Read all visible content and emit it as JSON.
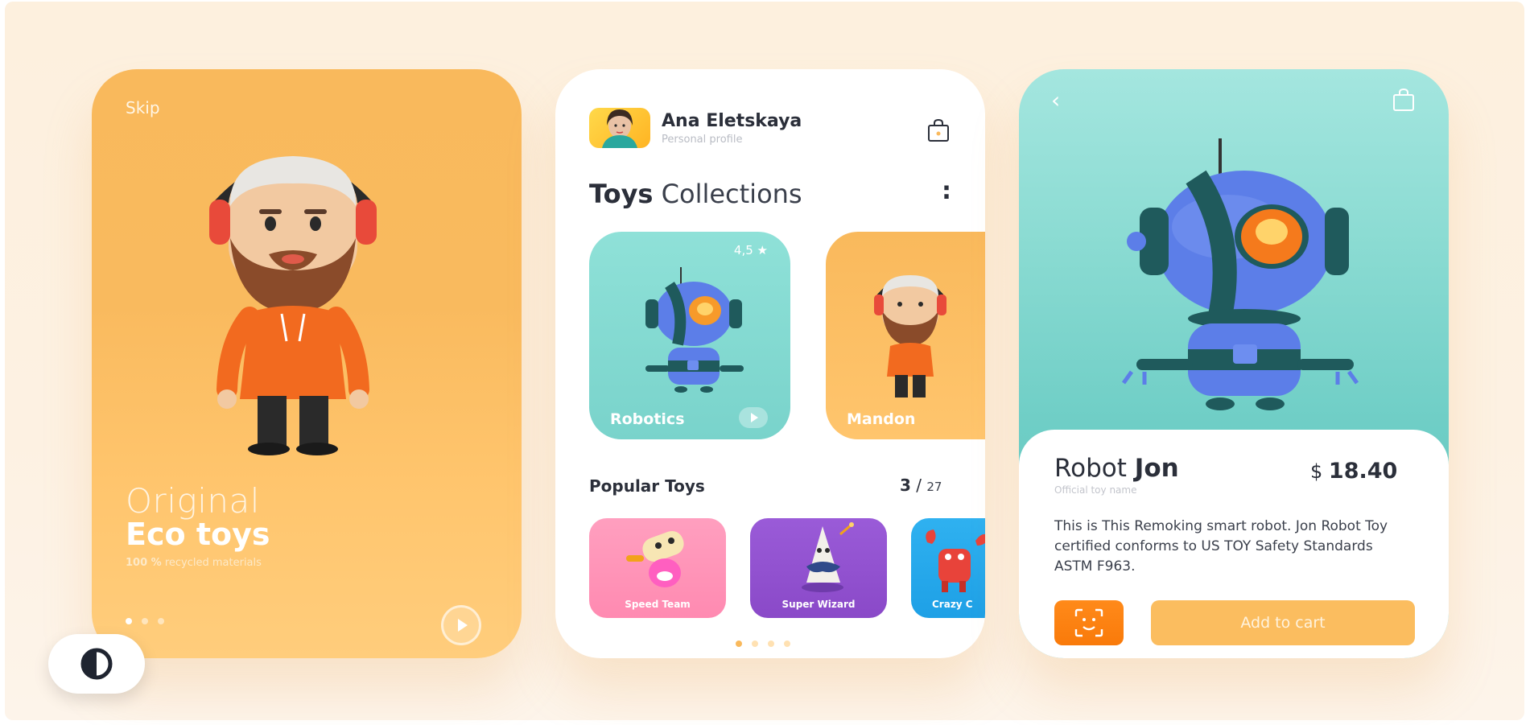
{
  "phone1": {
    "skip_label": "Skip",
    "title_line1": "Original",
    "title_line2": "Eco toys",
    "subtitle_bold": "100 %",
    "subtitle_rest": "recycled materials",
    "dots_total": 3,
    "dots_active": 1
  },
  "phone2": {
    "user_name": "Ana Eletskaya",
    "user_role": "Personal profile",
    "collections_bold": "Toys",
    "collections_rest": "Collections",
    "more_label": ":",
    "collections": [
      {
        "label": "Robotics",
        "rating": "4,5 ★",
        "color": "#7dd6cd"
      },
      {
        "label": "Mandon",
        "color": "#f9b95c"
      }
    ],
    "popular_title": "Popular Toys",
    "popular_current": "3",
    "popular_sep": "/",
    "popular_total": "27",
    "toys": [
      {
        "label": "Speed Team",
        "color": "#ff94b7"
      },
      {
        "label": "Super Wizard",
        "color": "#9252d0"
      },
      {
        "label": "Crazy C",
        "color": "#26a8ec"
      }
    ],
    "dots_total": 4,
    "dots_active": 1
  },
  "phone3": {
    "back_icon": "chevron-left-icon",
    "bag_icon": "shopping-bag-icon",
    "product_name_light": "Robot",
    "product_name_bold": "Jon",
    "product_sub": "Official toy name",
    "price_symbol": "$",
    "price_value": "18.40",
    "description": "This is This Remoking smart robot. Jon Robot Toy certified conforms to US TOY Safety Standards ASTM F963.",
    "add_to_cart_label": "Add to cart",
    "accent_color": "#f97a0a"
  },
  "colors": {
    "orange": "#f9b95c",
    "teal": "#7dd6cd",
    "background": "#fdf0de"
  }
}
